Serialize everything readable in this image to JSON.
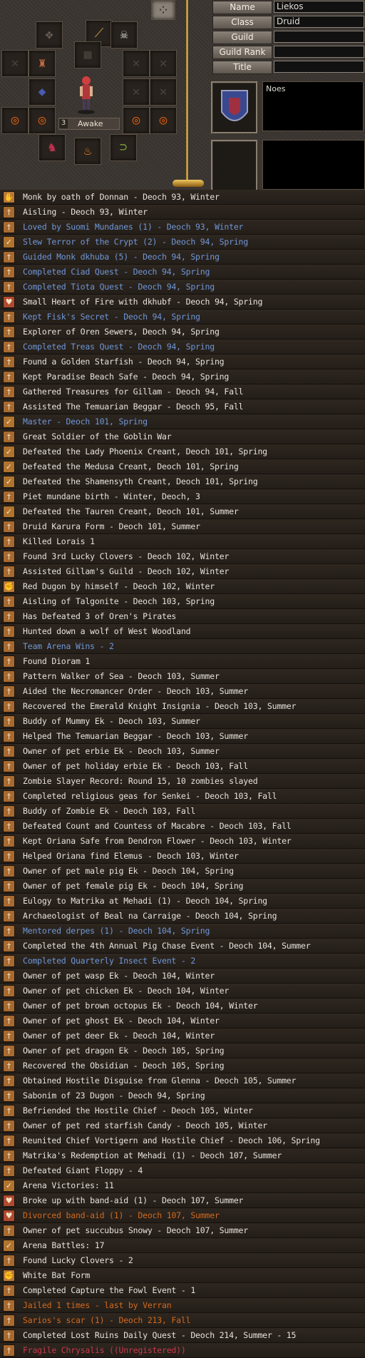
{
  "character": {
    "status_level": "3",
    "status_label": "Awake",
    "profile_text": "Noes",
    "fields": [
      {
        "label": "Name",
        "value": "Liekos"
      },
      {
        "label": "Class",
        "value": "Druid"
      },
      {
        "label": "Guild",
        "value": ""
      },
      {
        "label": "Guild Rank",
        "value": ""
      },
      {
        "label": "Title",
        "value": ""
      }
    ]
  },
  "equipment_slots": [
    {
      "slot": "helmet-socket",
      "icon": "gear-socket-icon",
      "color": "#6b6055",
      "glyph": "✥"
    },
    {
      "slot": "gem-left",
      "icon": "gem-icon",
      "color": "#3c4fa0",
      "glyph": "◆"
    },
    {
      "slot": "weapon",
      "icon": "sword-icon",
      "color": "#c4a04a",
      "glyph": "⟋"
    },
    {
      "slot": "accessory-skull",
      "icon": "skull-icon",
      "color": "#d8d8d8",
      "glyph": "☠"
    },
    {
      "slot": "empty-left-1",
      "icon": "empty-slot-icon",
      "color": "#4a433c",
      "glyph": "✕"
    },
    {
      "slot": "armor-figure",
      "icon": "armor-icon",
      "color": "#c06a40",
      "glyph": "♜"
    },
    {
      "slot": "empty-mid",
      "icon": "empty-slot-icon",
      "color": "#4a433c",
      "glyph": "▦"
    },
    {
      "slot": "empty-right-1",
      "icon": "empty-slot-icon",
      "color": "#4a433c",
      "glyph": "✕"
    },
    {
      "slot": "empty-right-2",
      "icon": "empty-slot-icon",
      "color": "#4a433c",
      "glyph": "✕"
    },
    {
      "slot": "gem-lower-left",
      "icon": "gem-icon",
      "color": "#4a5ab0",
      "glyph": "◆"
    },
    {
      "slot": "empty-right-3",
      "icon": "empty-slot-icon",
      "color": "#4a433c",
      "glyph": "✕"
    },
    {
      "slot": "empty-right-4",
      "icon": "empty-slot-icon",
      "color": "#4a433c",
      "glyph": "✕"
    },
    {
      "slot": "ring-left-1",
      "icon": "fire-ring-icon",
      "color": "#e06010",
      "glyph": "◎"
    },
    {
      "slot": "ring-left-2",
      "icon": "fire-ring-icon",
      "color": "#e06010",
      "glyph": "◎"
    },
    {
      "slot": "ring-right-1",
      "icon": "fire-ring-icon",
      "color": "#e06010",
      "glyph": "◎"
    },
    {
      "slot": "ring-right-2",
      "icon": "fire-ring-icon",
      "color": "#e06010",
      "glyph": "◎"
    },
    {
      "slot": "boots",
      "icon": "boots-icon",
      "color": "#c03050",
      "glyph": "♞"
    },
    {
      "slot": "flame",
      "icon": "flame-icon",
      "color": "#f08020",
      "glyph": "♨"
    },
    {
      "slot": "necklace",
      "icon": "necklace-icon",
      "color": "#80a040",
      "glyph": "⊃"
    }
  ],
  "menu_button": {
    "icon": "menu-grid-icon",
    "glyph": "⁘"
  },
  "legend_icon_colors": {
    "hand": "#b87a3a",
    "sword": "#a86a30",
    "heart": "#b04a30",
    "check": "#b0742e",
    "fist": "#b87a3a"
  },
  "legend_colors": {
    "white": "#e6e2da",
    "blue": "#6f97d8",
    "orange": "#d26a1e",
    "red": "#c63a4a"
  },
  "legends": [
    {
      "icon": "hand",
      "color": "white",
      "text": "Monk by oath of Donnan - Deoch 93, Winter"
    },
    {
      "icon": "sword",
      "color": "white",
      "text": "Aisling - Deoch 93, Winter"
    },
    {
      "icon": "sword",
      "color": "blue",
      "text": "Loved by Suomi Mundanes (1) - Deoch 93, Winter"
    },
    {
      "icon": "check",
      "color": "blue",
      "text": "Slew Terror of the Crypt (2) - Deoch 94, Spring"
    },
    {
      "icon": "sword",
      "color": "blue",
      "text": "Guided Monk dkhuba (5) - Deoch 94, Spring"
    },
    {
      "icon": "sword",
      "color": "blue",
      "text": "Completed Ciad Quest - Deoch 94, Spring"
    },
    {
      "icon": "sword",
      "color": "blue",
      "text": "Completed Tiota Quest - Deoch 94, Spring"
    },
    {
      "icon": "heart",
      "color": "white",
      "text": "Small Heart of Fire with dkhubf - Deoch 94, Spring"
    },
    {
      "icon": "sword",
      "color": "blue",
      "text": "Kept Fisk's Secret - Deoch 94, Spring"
    },
    {
      "icon": "sword",
      "color": "white",
      "text": "Explorer of Oren Sewers, Deoch 94, Spring"
    },
    {
      "icon": "sword",
      "color": "blue",
      "text": "Completed Treas Quest - Deoch 94, Spring"
    },
    {
      "icon": "sword",
      "color": "white",
      "text": "Found a Golden Starfish - Deoch 94, Spring"
    },
    {
      "icon": "sword",
      "color": "white",
      "text": "Kept Paradise Beach Safe - Deoch 94, Spring"
    },
    {
      "icon": "sword",
      "color": "white",
      "text": "Gathered Treasures for Gillam - Deoch 94, Fall"
    },
    {
      "icon": "sword",
      "color": "white",
      "text": "Assisted The Temuarian Beggar - Deoch 95, Fall"
    },
    {
      "icon": "check",
      "color": "blue",
      "text": "Master - Deoch 101, Spring"
    },
    {
      "icon": "sword",
      "color": "white",
      "text": "Great Soldier of the Goblin War"
    },
    {
      "icon": "check",
      "color": "white",
      "text": "Defeated the Lady Phoenix Creant, Deoch 101, Spring"
    },
    {
      "icon": "check",
      "color": "white",
      "text": "Defeated the Medusa Creant, Deoch 101, Spring"
    },
    {
      "icon": "check",
      "color": "white",
      "text": "Defeated the Shamensyth Creant, Deoch 101, Spring"
    },
    {
      "icon": "sword",
      "color": "white",
      "text": "Piet mundane birth - Winter, Deoch, 3"
    },
    {
      "icon": "check",
      "color": "white",
      "text": "Defeated the Tauren Creant, Deoch 101, Summer"
    },
    {
      "icon": "sword",
      "color": "white",
      "text": "Druid Karura Form - Deoch 101, Summer"
    },
    {
      "icon": "sword",
      "color": "white",
      "text": "Killed Lorais 1"
    },
    {
      "icon": "sword",
      "color": "white",
      "text": "Found 3rd Lucky Clovers - Deoch 102, Winter"
    },
    {
      "icon": "sword",
      "color": "white",
      "text": "Assisted Gillam's Guild - Deoch 102, Winter"
    },
    {
      "icon": "fist",
      "color": "white",
      "text": "Red Dugon by himself - Deoch 102, Winter"
    },
    {
      "icon": "sword",
      "color": "white",
      "text": "Aisling of Talgonite - Deoch 103, Spring"
    },
    {
      "icon": "sword",
      "color": "white",
      "text": "Has Defeated 3 of Oren's Pirates"
    },
    {
      "icon": "sword",
      "color": "white",
      "text": "Hunted down a wolf of West Woodland"
    },
    {
      "icon": "sword",
      "color": "blue",
      "text": "Team Arena Wins - 2"
    },
    {
      "icon": "sword",
      "color": "white",
      "text": "Found Dioram 1"
    },
    {
      "icon": "sword",
      "color": "white",
      "text": "Pattern Walker of Sea - Deoch 103, Summer"
    },
    {
      "icon": "sword",
      "color": "white",
      "text": "Aided the Necromancer Order - Deoch 103, Summer"
    },
    {
      "icon": "sword",
      "color": "white",
      "text": "Recovered the Emerald Knight Insignia - Deoch 103, Summer"
    },
    {
      "icon": "sword",
      "color": "white",
      "text": "Buddy of Mummy Ek - Deoch 103, Summer"
    },
    {
      "icon": "sword",
      "color": "white",
      "text": "Helped The Temuarian Beggar - Deoch 103, Summer"
    },
    {
      "icon": "sword",
      "color": "white",
      "text": "Owner of pet erbie Ek - Deoch 103, Summer"
    },
    {
      "icon": "sword",
      "color": "white",
      "text": "Owner of pet holiday erbie Ek - Deoch 103, Fall"
    },
    {
      "icon": "sword",
      "color": "white",
      "text": "Zombie Slayer Record: Round 15, 10 zombies slayed"
    },
    {
      "icon": "sword",
      "color": "white",
      "text": "Completed religious geas for Senkei - Deoch 103, Fall"
    },
    {
      "icon": "sword",
      "color": "white",
      "text": "Buddy of Zombie Ek - Deoch 103, Fall"
    },
    {
      "icon": "sword",
      "color": "white",
      "text": "Defeated Count and Countess of Macabre - Deoch 103, Fall"
    },
    {
      "icon": "sword",
      "color": "white",
      "text": "Kept Oriana Safe from Dendron Flower - Deoch 103, Winter"
    },
    {
      "icon": "sword",
      "color": "white",
      "text": "Helped Oriana find Elemus - Deoch 103, Winter"
    },
    {
      "icon": "sword",
      "color": "white",
      "text": "Owner of pet male pig Ek - Deoch 104, Spring"
    },
    {
      "icon": "sword",
      "color": "white",
      "text": "Owner of pet female pig Ek - Deoch 104, Spring"
    },
    {
      "icon": "sword",
      "color": "white",
      "text": "Eulogy to Matrika at Mehadi (1) - Deoch 104, Spring"
    },
    {
      "icon": "sword",
      "color": "white",
      "text": "Archaeologist of Beal na Carraige - Deoch 104, Spring"
    },
    {
      "icon": "sword",
      "color": "blue",
      "text": "Mentored derpes (1) - Deoch 104, Spring"
    },
    {
      "icon": "sword",
      "color": "white",
      "text": "Completed the 4th Annual Pig Chase Event - Deoch 104, Summer"
    },
    {
      "icon": "sword",
      "color": "blue",
      "text": "Completed Quarterly Insect Event - 2"
    },
    {
      "icon": "sword",
      "color": "white",
      "text": "Owner of pet wasp Ek - Deoch 104, Winter"
    },
    {
      "icon": "sword",
      "color": "white",
      "text": "Owner of pet chicken Ek - Deoch 104, Winter"
    },
    {
      "icon": "sword",
      "color": "white",
      "text": "Owner of pet brown octopus Ek - Deoch 104, Winter"
    },
    {
      "icon": "sword",
      "color": "white",
      "text": "Owner of pet ghost Ek - Deoch 104, Winter"
    },
    {
      "icon": "sword",
      "color": "white",
      "text": "Owner of pet deer Ek - Deoch 104, Winter"
    },
    {
      "icon": "sword",
      "color": "white",
      "text": "Owner of pet dragon Ek - Deoch 105, Spring"
    },
    {
      "icon": "sword",
      "color": "white",
      "text": "Recovered the Obsidian - Deoch 105, Spring"
    },
    {
      "icon": "sword",
      "color": "white",
      "text": "Obtained Hostile Disguise from Glenna - Deoch 105, Summer"
    },
    {
      "icon": "sword",
      "color": "white",
      "text": "Sabonim of 23 Dugon - Deoch 94, Spring"
    },
    {
      "icon": "sword",
      "color": "white",
      "text": "Befriended the Hostile Chief - Deoch 105, Winter"
    },
    {
      "icon": "sword",
      "color": "white",
      "text": "Owner of pet red starfish Candy - Deoch 105, Winter"
    },
    {
      "icon": "sword",
      "color": "white",
      "text": "Reunited Chief Vortigern and Hostile Chief - Deoch 106, Spring"
    },
    {
      "icon": "sword",
      "color": "white",
      "text": "Matrika's Redemption at Mehadi (1) - Deoch 107, Summer"
    },
    {
      "icon": "sword",
      "color": "white",
      "text": "Defeated Giant Floppy - 4"
    },
    {
      "icon": "check",
      "color": "white",
      "text": "Arena Victories: 11"
    },
    {
      "icon": "heart",
      "color": "white",
      "text": "Broke up with band-aid (1) - Deoch 107, Summer"
    },
    {
      "icon": "heart",
      "color": "orange",
      "text": "Divorced band-aid (1) - Deoch 107, Summer"
    },
    {
      "icon": "sword",
      "color": "white",
      "text": "Owner of pet succubus Snowy - Deoch 107, Summer"
    },
    {
      "icon": "check",
      "color": "white",
      "text": "Arena Battles: 17"
    },
    {
      "icon": "sword",
      "color": "white",
      "text": "Found Lucky Clovers - 2"
    },
    {
      "icon": "fist",
      "color": "white",
      "text": "White Bat Form"
    },
    {
      "icon": "sword",
      "color": "white",
      "text": "Completed Capture the Fowl Event - 1"
    },
    {
      "icon": "sword",
      "color": "orange",
      "text": "Jailed 1 times - last by Verran"
    },
    {
      "icon": "sword",
      "color": "orange",
      "text": "Sarios's scar (1) - Deoch 213, Fall"
    },
    {
      "icon": "sword",
      "color": "white",
      "text": "Completed Lost Ruins Daily Quest - Deoch 214, Summer - 15"
    },
    {
      "icon": "sword",
      "color": "red",
      "text": "Fragile Chrysalis ((Unregistered))"
    }
  ]
}
